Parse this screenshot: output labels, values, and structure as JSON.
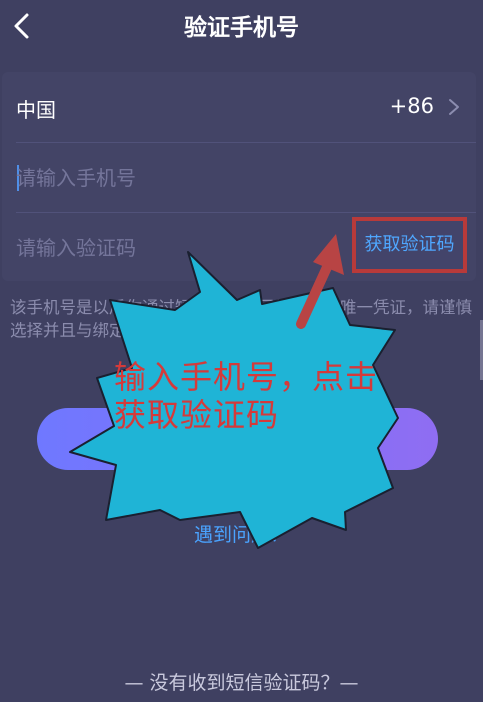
{
  "header": {
    "title": "验证手机号",
    "back_icon": "chevron-left-icon"
  },
  "form": {
    "country_name": "中国",
    "country_code": "+86",
    "phone_placeholder": "请输入手机号",
    "code_placeholder": "请输入验证码",
    "get_code_label": "获取验证码"
  },
  "tip": "该手机号是以后你通过短信验证取回将军令的唯一凭证，请谨慎选择并且与绑定时间不变",
  "help_link": "遇到问题？",
  "footer_link": "— 没有收到短信验证码？—",
  "annotation": {
    "callout_text": "输入手机号，点击获取验证码",
    "callout_color": "#1fb4d6",
    "text_color": "#d53a3a",
    "highlight_color": "#b83a3a"
  },
  "colors": {
    "background": "#3f4061",
    "card": "#434466",
    "link": "#4fa7ff",
    "button_gradient_start": "#6f78ff",
    "button_gradient_end": "#8f6df2"
  }
}
